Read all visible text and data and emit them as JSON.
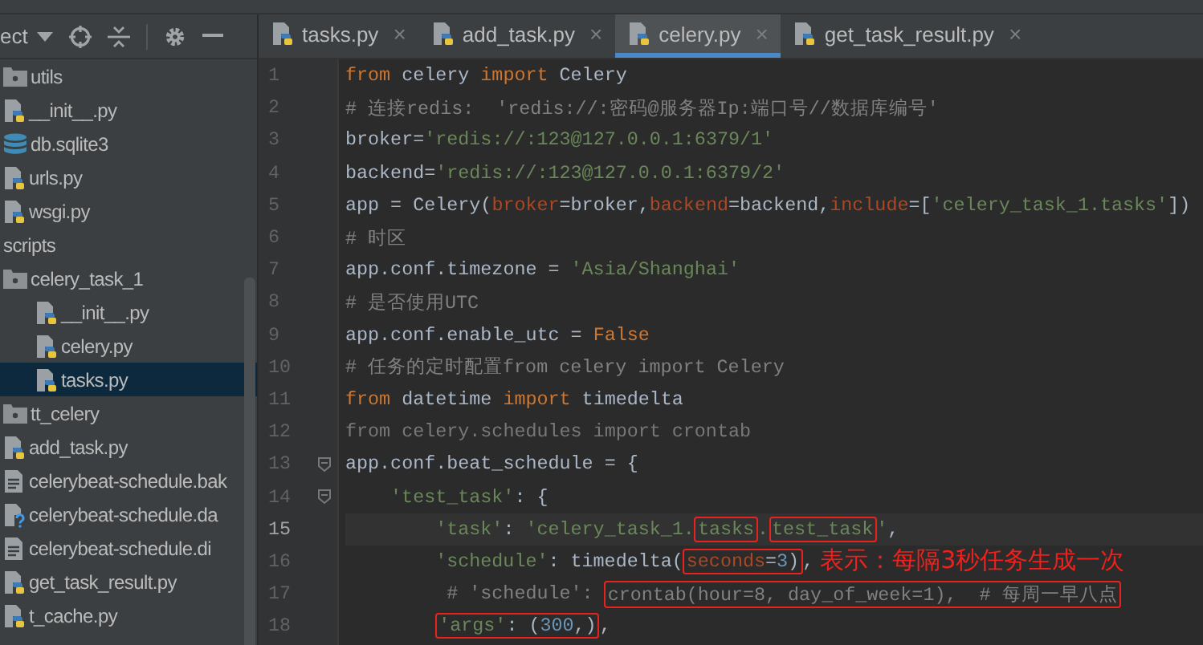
{
  "project_toolbar": {
    "view_label": "ect"
  },
  "tree": [
    {
      "label": "utils",
      "kind": "folder",
      "selected": false
    },
    {
      "label": "__init__.py",
      "kind": "python",
      "selected": false
    },
    {
      "label": "db.sqlite3",
      "kind": "database",
      "selected": false
    },
    {
      "label": "urls.py",
      "kind": "python",
      "selected": false
    },
    {
      "label": "wsgi.py",
      "kind": "python",
      "selected": false
    },
    {
      "label": "scripts",
      "kind": "plain",
      "selected": false
    },
    {
      "label": "celery_task_1",
      "kind": "folder",
      "selected": false,
      "children": [
        {
          "label": "__init__.py",
          "kind": "python",
          "selected": false
        },
        {
          "label": "celery.py",
          "kind": "python",
          "selected": false
        },
        {
          "label": "tasks.py",
          "kind": "python",
          "selected": true
        }
      ]
    },
    {
      "label": "tt_celery",
      "kind": "folder",
      "selected": false
    },
    {
      "label": "add_task.py",
      "kind": "python",
      "selected": false
    },
    {
      "label": "celerybeat-schedule.bak",
      "kind": "text",
      "selected": false
    },
    {
      "label": "celerybeat-schedule.da",
      "kind": "unknown",
      "selected": false
    },
    {
      "label": "celerybeat-schedule.di",
      "kind": "text",
      "selected": false
    },
    {
      "label": "get_task_result.py",
      "kind": "python",
      "selected": false
    },
    {
      "label": "t_cache.py",
      "kind": "python",
      "selected": false
    }
  ],
  "tabs": [
    {
      "label": "tasks.py",
      "close": "×",
      "selected": false
    },
    {
      "label": "add_task.py",
      "close": "×",
      "selected": false
    },
    {
      "label": "celery.py",
      "close": "×",
      "selected": true
    },
    {
      "label": "get_task_result.py",
      "close": "×",
      "selected": false
    }
  ],
  "code_lines": [
    {
      "number": "1",
      "current": false,
      "fold": false,
      "tokens": [
        {
          "kind": "keyword",
          "text": "from"
        },
        {
          "kind": "plain",
          "text": " celery "
        },
        {
          "kind": "keyword",
          "text": "import"
        },
        {
          "kind": "plain",
          "text": " Celery"
        }
      ]
    },
    {
      "number": "2",
      "current": false,
      "fold": false,
      "tokens": [
        {
          "kind": "comment",
          "text": "# 连接redis:  'redis://:密码@服务器Ip:端口号//数据库编号'"
        }
      ]
    },
    {
      "number": "3",
      "current": false,
      "fold": false,
      "tokens": [
        {
          "kind": "plain",
          "text": "broker="
        },
        {
          "kind": "string",
          "text": "'redis://:123@127.0.0.1:6379/1'"
        }
      ]
    },
    {
      "number": "4",
      "current": false,
      "fold": false,
      "tokens": [
        {
          "kind": "plain",
          "text": "backend="
        },
        {
          "kind": "string",
          "text": "'redis://:123@127.0.0.1:6379/2'"
        }
      ]
    },
    {
      "number": "5",
      "current": false,
      "fold": false,
      "tokens": [
        {
          "kind": "plain",
          "text": "app = Celery("
        },
        {
          "kind": "param",
          "text": "broker"
        },
        {
          "kind": "plain",
          "text": "=broker,"
        },
        {
          "kind": "param",
          "text": "backend"
        },
        {
          "kind": "plain",
          "text": "=backend,"
        },
        {
          "kind": "param",
          "text": "include"
        },
        {
          "kind": "plain",
          "text": "=["
        },
        {
          "kind": "string",
          "text": "'celery_task_1.tasks'"
        },
        {
          "kind": "plain",
          "text": "])"
        }
      ]
    },
    {
      "number": "6",
      "current": false,
      "fold": false,
      "tokens": [
        {
          "kind": "comment",
          "text": "# 时区"
        }
      ]
    },
    {
      "number": "7",
      "current": false,
      "fold": false,
      "tokens": [
        {
          "kind": "plain",
          "text": "app.conf.timezone = "
        },
        {
          "kind": "string",
          "text": "'Asia/Shanghai'"
        }
      ]
    },
    {
      "number": "8",
      "current": false,
      "fold": false,
      "tokens": [
        {
          "kind": "comment",
          "text": "# 是否使用UTC"
        }
      ]
    },
    {
      "number": "9",
      "current": false,
      "fold": false,
      "tokens": [
        {
          "kind": "plain",
          "text": "app.conf.enable_utc = "
        },
        {
          "kind": "keyword",
          "text": "False"
        }
      ]
    },
    {
      "number": "10",
      "current": false,
      "fold": false,
      "tokens": [
        {
          "kind": "comment",
          "text": "# 任务的定时配置from celery import Celery"
        }
      ]
    },
    {
      "number": "11",
      "current": false,
      "fold": false,
      "tokens": [
        {
          "kind": "keyword",
          "text": "from"
        },
        {
          "kind": "plain",
          "text": " datetime "
        },
        {
          "kind": "keyword",
          "text": "import"
        },
        {
          "kind": "plain",
          "text": " timedelta"
        }
      ]
    },
    {
      "number": "12",
      "current": false,
      "fold": false,
      "tokens": [
        {
          "kind": "unused",
          "text": "from celery.schedules import crontab"
        }
      ]
    },
    {
      "number": "13",
      "current": false,
      "fold": true,
      "tokens": [
        {
          "kind": "plain",
          "text": "app.conf.beat_schedule = {"
        }
      ],
      "children": [
        {
          "number": "14",
          "current": false,
          "fold": true,
          "tokens": [
            {
              "kind": "string",
              "text": "'test_task'"
            },
            {
              "kind": "plain",
              "text": ": {"
            }
          ],
          "children": [
            {
              "number": "15",
              "current": true,
              "fold": false,
              "tokens": [
                {
                  "kind": "string",
                  "text": "'task'"
                },
                {
                  "kind": "plain",
                  "text": ": "
                },
                {
                  "kind": "string",
                  "text": "'celery_task_1."
                },
                {
                  "kind": "box",
                  "parts": [
                    {
                      "kind": "string",
                      "text": "tasks"
                    }
                  ]
                },
                {
                  "kind": "string",
                  "text": "."
                },
                {
                  "kind": "box",
                  "parts": [
                    {
                      "kind": "string",
                      "text": "test_task"
                    }
                  ]
                },
                {
                  "kind": "string",
                  "text": "'"
                },
                {
                  "kind": "plain",
                  "text": ","
                }
              ]
            },
            {
              "number": "16",
              "current": false,
              "fold": false,
              "tokens": [
                {
                  "kind": "string",
                  "text": "'schedule'"
                },
                {
                  "kind": "plain",
                  "text": ": timedelta("
                },
                {
                  "kind": "box",
                  "parts": [
                    {
                      "kind": "param",
                      "text": "seconds"
                    },
                    {
                      "kind": "plain",
                      "text": "="
                    },
                    {
                      "kind": "number",
                      "text": "3"
                    },
                    {
                      "kind": "plain",
                      "text": ")"
                    }
                  ]
                },
                {
                  "kind": "plain",
                  "text": ","
                },
                {
                  "kind": "note",
                  "text": "表示：每隔3秒任务生成一次"
                }
              ]
            },
            {
              "number": "17",
              "current": false,
              "fold": false,
              "tokens": [
                {
                  "kind": "comment",
                  "text": " # 'schedule': "
                },
                {
                  "kind": "box",
                  "parts": [
                    {
                      "kind": "comment",
                      "text": "crontab(hour=8, day_of_week=1),  # 每周一早八点"
                    }
                  ]
                }
              ]
            },
            {
              "number": "18",
              "current": false,
              "fold": false,
              "tokens": [
                {
                  "kind": "box",
                  "parts": [
                    {
                      "kind": "string",
                      "text": "'args'"
                    },
                    {
                      "kind": "plain",
                      "text": ": ("
                    },
                    {
                      "kind": "number",
                      "text": "300"
                    },
                    {
                      "kind": "plain",
                      "text": ",)"
                    }
                  ]
                },
                {
                  "kind": "plain",
                  "text": ","
                }
              ]
            }
          ]
        }
      ]
    }
  ]
}
